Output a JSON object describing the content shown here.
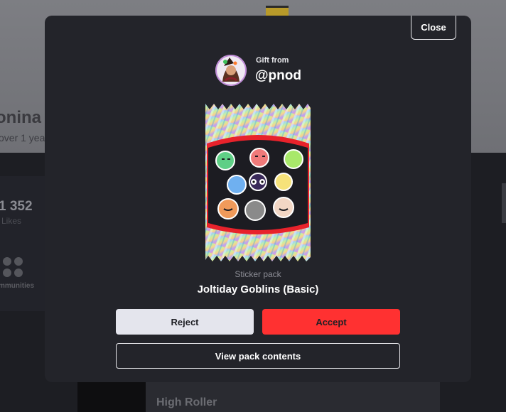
{
  "background": {
    "profile_name_fragment": "onina",
    "profile_sub_fragment": "over 1 yea",
    "likes_count": "1 352",
    "likes_label": "Likes",
    "communities_label": "mmunities",
    "card_title": "High Roller"
  },
  "modal": {
    "close_label": "Close",
    "gift_from_label": "Gift from",
    "sender_handle": "@pnod",
    "pack_type": "Sticker pack",
    "pack_name": "Joltiday Goblins (Basic)",
    "reject_label": "Reject",
    "accept_label": "Accept",
    "view_contents_label": "View pack contents"
  },
  "colors": {
    "modal_bg": "#23242a",
    "accept": "#ff3131",
    "reject": "#e4e5ed",
    "pack_accent": "#e8222b"
  }
}
